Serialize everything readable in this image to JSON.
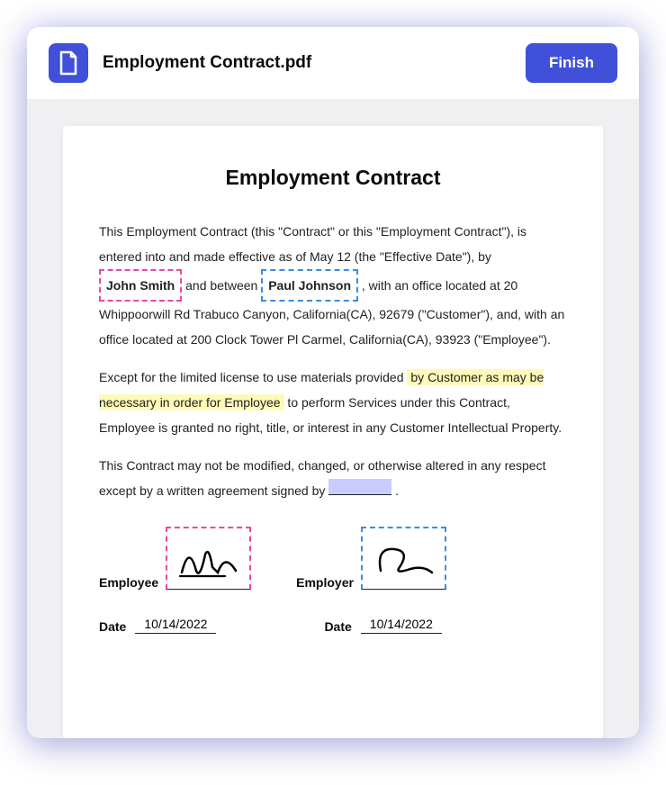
{
  "header": {
    "filename": "Employment Contract.pdf",
    "finish_label": "Finish"
  },
  "document": {
    "title": "Employment Contract",
    "para1": {
      "seg1": "This Employment Contract (this \"Contract\" or this \"Employment Contract\"), is entered into and made effective as of May 12 (the \"Effective Date\"), by ",
      "field1": "John Smith",
      "seg2": " and between ",
      "field2": "Paul Johnson",
      "seg3": " , with an office located at 20 Whippoorwill Rd Trabuco Canyon, California(CA), 92679 (\"Customer\"), and, with an office located at 200 Clock Tower Pl Carmel, California(CA), 93923 (\"Employee\")."
    },
    "para2": {
      "seg1": "Except for the limited license to use materials provided ",
      "hl1": "by Customer as may be necessary in order for Employee",
      "seg2": " to perform Services under this Contract, Employee is granted no right, title, or interest in any Customer Intellectual Property."
    },
    "para3": {
      "seg1": "This Contract may not be modified, changed, or otherwise altered in any respect except by a written agreement signed by ",
      "seg2": " ."
    },
    "signatures": {
      "employee_label": "Employee",
      "employer_label": "Employer"
    },
    "dates": {
      "date_label": "Date",
      "date1": "10/14/2022",
      "date2": "10/14/2022"
    }
  }
}
